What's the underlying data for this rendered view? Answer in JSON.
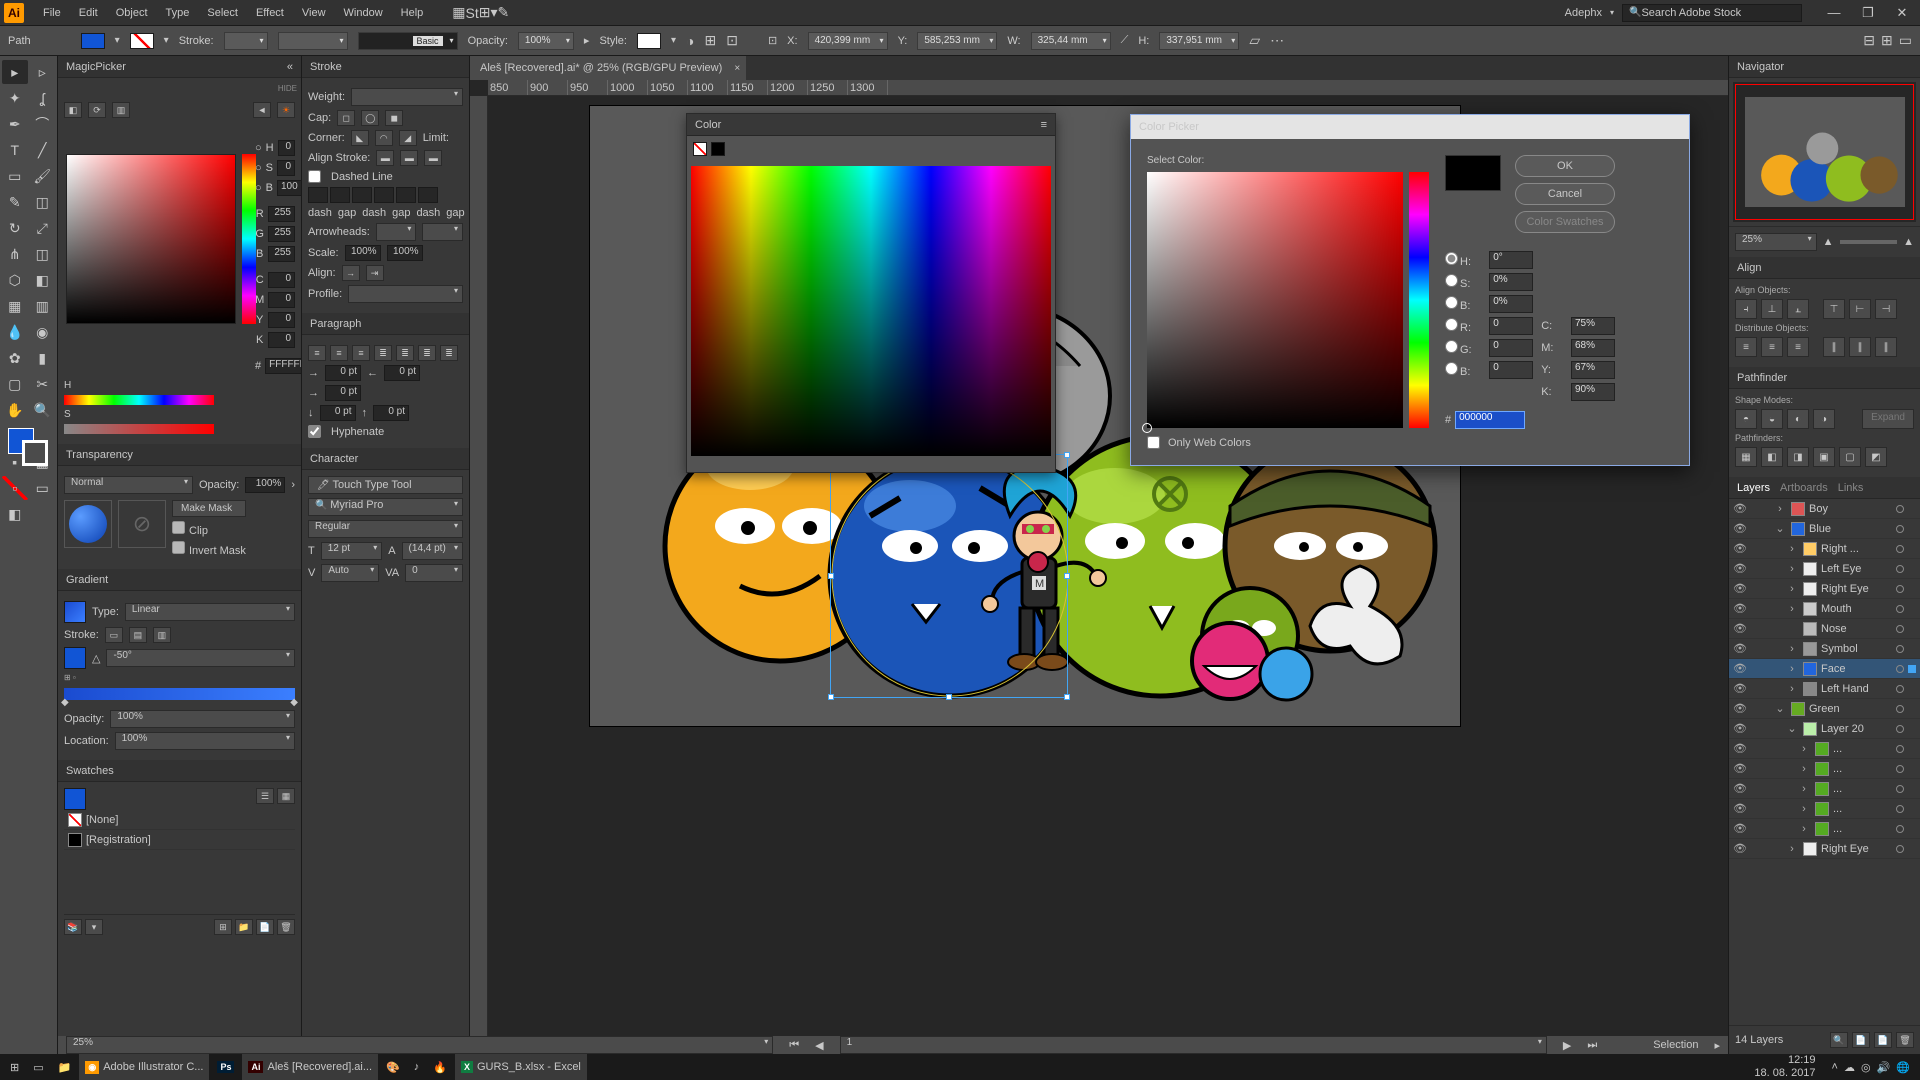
{
  "menubar": {
    "items": [
      "File",
      "Edit",
      "Object",
      "Type",
      "Select",
      "Effect",
      "View",
      "Window",
      "Help"
    ],
    "user": "Adephx",
    "search_placeholder": "Search Adobe Stock"
  },
  "controlbar": {
    "left_label": "Path",
    "stroke_label": "Stroke:",
    "style_label": "Style:",
    "stroke_preset": "Basic",
    "opacity_label": "Opacity:",
    "opacity_value": "100%",
    "x_label": "X:",
    "x_value": "420,399 mm",
    "y_label": "Y:",
    "y_value": "585,253 mm",
    "w_label": "W:",
    "w_value": "325,44 mm",
    "h_label": "H:",
    "h_value": "337,951 mm"
  },
  "doc_tab": "Aleš [Recovered].ai* @ 25% (RGB/GPU Preview)",
  "panels": {
    "magicpicker": {
      "title": "MagicPicker",
      "hide_btn": "HIDE",
      "H": {
        "label": "H",
        "value": "0"
      },
      "S": {
        "label": "S",
        "value": "0"
      },
      "B": {
        "label": "B",
        "value": "100"
      },
      "R": {
        "label": "R",
        "value": "255"
      },
      "G": {
        "label": "G",
        "value": "255"
      },
      "Bb": {
        "label": "B",
        "value": "255"
      },
      "C": {
        "label": "C",
        "value": "0"
      },
      "M": {
        "label": "M",
        "value": "0"
      },
      "Y": {
        "label": "Y",
        "value": "0"
      },
      "K": {
        "label": "K",
        "value": "0"
      },
      "hex": "FFFFFF"
    },
    "transparency": {
      "title": "Transparency",
      "mode": "Normal",
      "opacity_label": "Opacity:",
      "opacity": "100%",
      "make_mask": "Make Mask",
      "clip": "Clip",
      "invert": "Invert Mask"
    },
    "gradient": {
      "title": "Gradient",
      "type_label": "Type:",
      "type": "Linear",
      "stroke_label": "Stroke:",
      "angle": "-50°",
      "opacity_label": "Opacity:",
      "opacity": "100%",
      "loc_label": "Location:",
      "loc": "100%"
    },
    "swatches": {
      "title": "Swatches",
      "none": "[None]",
      "registration": "[Registration]"
    },
    "stroke": {
      "title": "Stroke",
      "weight_label": "Weight:",
      "cap_label": "Cap:",
      "corner_label": "Corner:",
      "limit_label": "Limit:",
      "align_label": "Align Stroke:",
      "dashed": "Dashed Line",
      "dash": "dash",
      "gap": "gap",
      "arrow_label": "Arrowheads:",
      "scale_label": "Scale:",
      "scale1": "100%",
      "scale2": "100%",
      "alignarrow": "Align:",
      "profile_label": "Profile:"
    },
    "paragraph": {
      "title": "Paragraph",
      "zero": "0 pt",
      "hyphenate": "Hyphenate"
    },
    "character": {
      "title": "Character",
      "touch": "Touch Type Tool",
      "font": "Myriad Pro",
      "style": "Regular",
      "size": "12 pt",
      "leading": "(14,4 pt)",
      "kerning": "Auto",
      "tracking": "0"
    },
    "color_float": {
      "title": "Color"
    },
    "navigator": {
      "title": "Navigator",
      "zoom": "25%"
    },
    "align": {
      "title": "Align",
      "objs": "Align Objects:",
      "dist": "Distribute Objects:"
    },
    "pathfinder": {
      "title": "Pathfinder",
      "shapemodes": "Shape Modes:",
      "expand": "Expand",
      "pf": "Pathfinders:"
    },
    "layers": {
      "title_tabs": [
        "Layers",
        "Artboards",
        "Links"
      ],
      "items": [
        {
          "name": "Boy",
          "indent": 0,
          "expand": "›",
          "color": "#d55",
          "sel": false
        },
        {
          "name": "Blue",
          "indent": 0,
          "expand": "⌄",
          "color": "#2266dd",
          "sel": false
        },
        {
          "name": "Right ...",
          "indent": 1,
          "expand": "›",
          "color": "#ffcc66",
          "sel": false
        },
        {
          "name": "Left Eye",
          "indent": 1,
          "expand": "›",
          "color": "#eee",
          "sel": false
        },
        {
          "name": "Right Eye",
          "indent": 1,
          "expand": "›",
          "color": "#eee",
          "sel": false
        },
        {
          "name": "Mouth",
          "indent": 1,
          "expand": "›",
          "color": "#ccc",
          "sel": false
        },
        {
          "name": "Nose",
          "indent": 1,
          "expand": "",
          "color": "#bbb",
          "sel": false
        },
        {
          "name": "Symbol",
          "indent": 1,
          "expand": "›",
          "color": "#999",
          "sel": false
        },
        {
          "name": "Face",
          "indent": 1,
          "expand": "›",
          "color": "#2266dd",
          "sel": true
        },
        {
          "name": "Left Hand",
          "indent": 1,
          "expand": "›",
          "color": "#888",
          "sel": false
        },
        {
          "name": "Green",
          "indent": 0,
          "expand": "⌄",
          "color": "#66aa22",
          "sel": false
        },
        {
          "name": "Layer 20",
          "indent": 1,
          "expand": "⌄",
          "color": "#bbeeaa",
          "sel": false
        },
        {
          "name": "...",
          "indent": 2,
          "expand": "›",
          "color": "#5a2",
          "sel": false
        },
        {
          "name": "...",
          "indent": 2,
          "expand": "›",
          "color": "#5a2",
          "sel": false
        },
        {
          "name": "...",
          "indent": 2,
          "expand": "›",
          "color": "#5a2",
          "sel": false
        },
        {
          "name": "...",
          "indent": 2,
          "expand": "›",
          "color": "#5a2",
          "sel": false
        },
        {
          "name": "...",
          "indent": 2,
          "expand": "›",
          "color": "#5a2",
          "sel": false
        },
        {
          "name": "Right Eye",
          "indent": 1,
          "expand": "›",
          "color": "#eee",
          "sel": false
        }
      ],
      "footer": "14 Layers"
    }
  },
  "color_picker": {
    "title": "Color Picker",
    "select": "Select Color:",
    "ok": "OK",
    "cancel": "Cancel",
    "swatches": "Color Swatches",
    "fields": {
      "H": "0°",
      "S": "0%",
      "B": "0%",
      "R": "0",
      "G": "0",
      "Bb": "0",
      "C": "75%",
      "M": "68%",
      "Y": "67%",
      "K": "90%"
    },
    "hex": "000000",
    "webcolors": "Only Web Colors"
  },
  "statusbar": {
    "zoom": "25%",
    "artboard": "1",
    "tool": "Selection"
  },
  "taskbar": {
    "apps": [
      {
        "icon": "⊞",
        "label": "",
        "active": false
      },
      {
        "icon": "▭",
        "label": "",
        "active": false
      },
      {
        "icon": "📁",
        "label": "",
        "active": false
      },
      {
        "icon": "◉",
        "label": "Adobe Illustrator C...",
        "active": true,
        "color": "#ff9a00"
      },
      {
        "icon": "Ps",
        "label": "",
        "active": false,
        "color": "#001d34"
      },
      {
        "icon": "Ai",
        "label": "Aleš [Recovered].ai...",
        "active": true,
        "color": "#330000"
      },
      {
        "icon": "🎨",
        "label": "",
        "active": false
      },
      {
        "icon": "♪",
        "label": "",
        "active": false
      },
      {
        "icon": "🔥",
        "label": "",
        "active": false
      },
      {
        "icon": "X",
        "label": "GURS_B.xlsx - Excel",
        "active": true,
        "color": "#107c41"
      }
    ],
    "time": "12:19",
    "date": "18. 08. 2017"
  },
  "ruler_ticks": [
    "850",
    "900",
    "950",
    "1000",
    "1050",
    "1100",
    "1150",
    "1200",
    "1250",
    "1300"
  ]
}
